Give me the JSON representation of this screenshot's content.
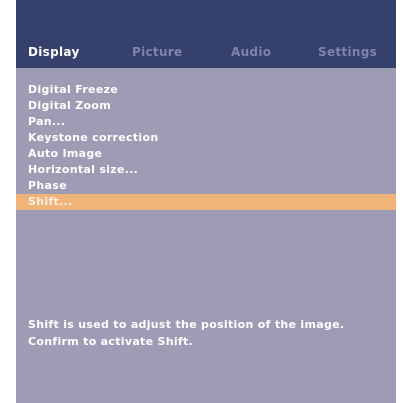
{
  "tabs": [
    {
      "label": "Display",
      "active": true
    },
    {
      "label": "Picture",
      "active": false
    },
    {
      "label": "Audio",
      "active": false
    },
    {
      "label": "Settings",
      "active": false
    }
  ],
  "menu": {
    "items": [
      "Digital Freeze",
      "Digital Zoom",
      "Pan...",
      "Keystone correction",
      "Auto Image",
      "Horizontal size...",
      "Phase",
      "Shift..."
    ],
    "selected_index": 7
  },
  "help": {
    "line1": "Shift is used to adjust the position of the image.",
    "line2": "Confirm to activate Shift."
  },
  "colors": {
    "header_bg": "#35406d",
    "panel_bg": "#9e9bb4",
    "highlight": "#f0b47a",
    "inactive_tab": "#7d85ad"
  }
}
